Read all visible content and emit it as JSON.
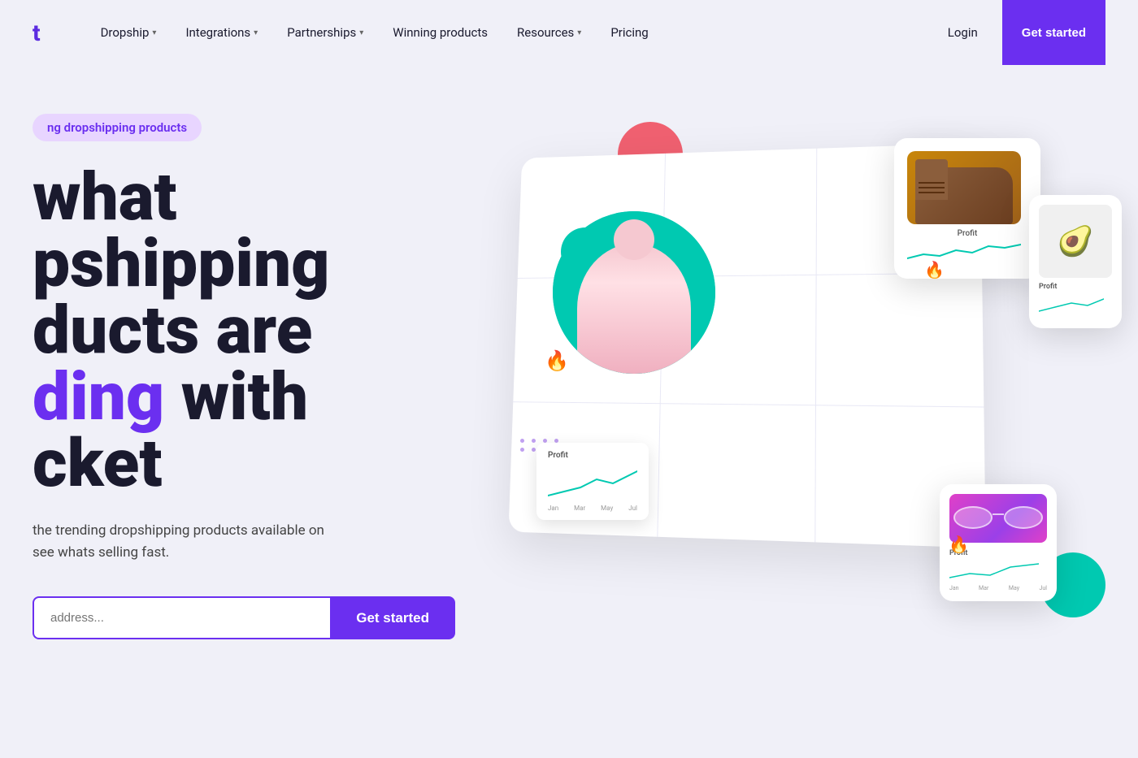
{
  "nav": {
    "logo": "t",
    "links": [
      {
        "label": "Dropship",
        "hasDropdown": true
      },
      {
        "label": "Integrations",
        "hasDropdown": true
      },
      {
        "label": "Partnerships",
        "hasDropdown": true
      },
      {
        "label": "Winning products",
        "hasDropdown": false
      },
      {
        "label": "Resources",
        "hasDropdown": true
      },
      {
        "label": "Pricing",
        "hasDropdown": false
      }
    ],
    "login": "Login",
    "cta": "Get started"
  },
  "hero": {
    "badge": "ng dropshipping products",
    "title_line1": "what",
    "title_line2": "pshipping",
    "title_line3": "ducts are",
    "title_highlight": "ding",
    "title_suffix": " with",
    "title_line5": "cket",
    "subtitle_line1": "the trending dropshipping products available on",
    "subtitle_line2": "see whats selling fast.",
    "input_placeholder": "address...",
    "button_label": "Get started"
  },
  "colors": {
    "purple": "#6b2ff0",
    "teal": "#00c9b1",
    "red": "#f05060",
    "pink": "#e040c8",
    "light_purple": "#b8a0f0",
    "badge_bg": "#e8d5ff"
  }
}
